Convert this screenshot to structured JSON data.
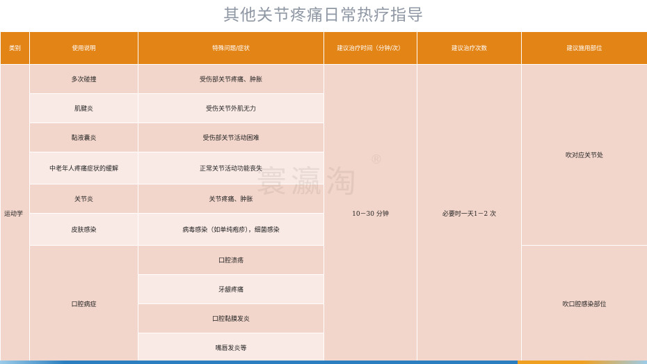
{
  "title": "其他关节疼痛日常热疗指导",
  "headers": [
    "类别",
    "使用说明",
    "特殊问题/症状",
    "建议治疗时间（分钟/次）",
    "建议治疗次数",
    "建议施用部位"
  ],
  "category": "运动学",
  "rows": [
    {
      "usage": "多次碰撞",
      "symptom": "受伤部关节疼痛、肿胀"
    },
    {
      "usage": "肌腱炎",
      "symptom": "受伤关节外肌无力"
    },
    {
      "usage": "黏液囊炎",
      "symptom": "受伤部关节活动困难"
    },
    {
      "usage": "中老年人疼痛症状的缓解",
      "symptom": "正常关节活动功能丧失"
    },
    {
      "usage": "关节炎",
      "symptom": "关节疼痛、肿胀"
    },
    {
      "usage": "皮肤感染",
      "symptom": "病毒感染（如单纯疱疹），细菌感染"
    }
  ],
  "oral": {
    "usage": "口腔病症",
    "symptoms": [
      "口腔溃疡",
      "牙龈疼痛",
      "口腔黏膜发炎",
      "嘴唇发炎等"
    ]
  },
  "duration": "10－30 分钟",
  "frequency": "必要时一天1－2 次",
  "site_joint": "吹对应关节处",
  "site_oral": "吹口腔感染部位",
  "watermark": "寰瀛淘",
  "watermark_mark": "®"
}
